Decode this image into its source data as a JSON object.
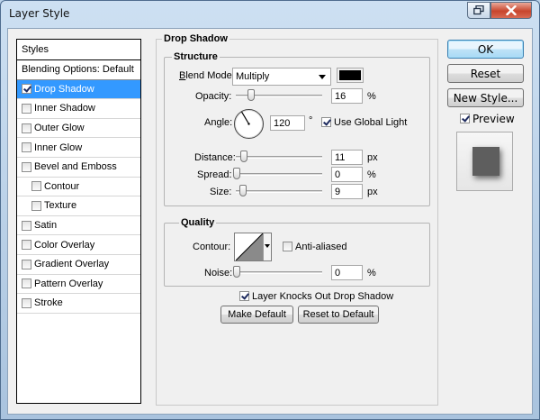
{
  "window": {
    "title": "Layer Style"
  },
  "styles_panel": {
    "header": "Styles",
    "blending_options": "Blending Options: Default",
    "items": [
      {
        "label": "Drop Shadow",
        "checked": true,
        "selected": true,
        "indent": false
      },
      {
        "label": "Inner Shadow",
        "checked": false,
        "selected": false,
        "indent": false
      },
      {
        "label": "Outer Glow",
        "checked": false,
        "selected": false,
        "indent": false
      },
      {
        "label": "Inner Glow",
        "checked": false,
        "selected": false,
        "indent": false
      },
      {
        "label": "Bevel and Emboss",
        "checked": false,
        "selected": false,
        "indent": false
      },
      {
        "label": "Contour",
        "checked": false,
        "selected": false,
        "indent": true
      },
      {
        "label": "Texture",
        "checked": false,
        "selected": false,
        "indent": true
      },
      {
        "label": "Satin",
        "checked": false,
        "selected": false,
        "indent": false
      },
      {
        "label": "Color Overlay",
        "checked": false,
        "selected": false,
        "indent": false
      },
      {
        "label": "Gradient Overlay",
        "checked": false,
        "selected": false,
        "indent": false
      },
      {
        "label": "Pattern Overlay",
        "checked": false,
        "selected": false,
        "indent": false
      },
      {
        "label": "Stroke",
        "checked": false,
        "selected": false,
        "indent": false
      }
    ]
  },
  "drop_shadow": {
    "title": "Drop Shadow",
    "structure": {
      "title": "Structure",
      "blend_mode_label": "Blend Mode:",
      "blend_mode_value": "Multiply",
      "shadow_color": "#000000",
      "opacity_label": "Opacity:",
      "opacity_value": "16",
      "opacity_unit": "%",
      "angle_label": "Angle:",
      "angle_value": "120",
      "angle_unit": "°",
      "use_global_light": "Use Global Light",
      "use_global_light_checked": true,
      "distance_label": "Distance:",
      "distance_value": "11",
      "distance_unit": "px",
      "spread_label": "Spread:",
      "spread_value": "0",
      "spread_unit": "%",
      "size_label": "Size:",
      "size_value": "9",
      "size_unit": "px"
    },
    "quality": {
      "title": "Quality",
      "contour_label": "Contour:",
      "anti_aliased": "Anti-aliased",
      "anti_aliased_checked": false,
      "noise_label": "Noise:",
      "noise_value": "0",
      "noise_unit": "%"
    },
    "layer_knocks_out": "Layer Knocks Out Drop Shadow",
    "layer_knocks_out_checked": true,
    "make_default": "Make Default",
    "reset_to_default": "Reset to Default"
  },
  "actions": {
    "ok": "OK",
    "reset": "Reset",
    "new_style": "New Style...",
    "preview": "Preview",
    "preview_checked": true
  }
}
